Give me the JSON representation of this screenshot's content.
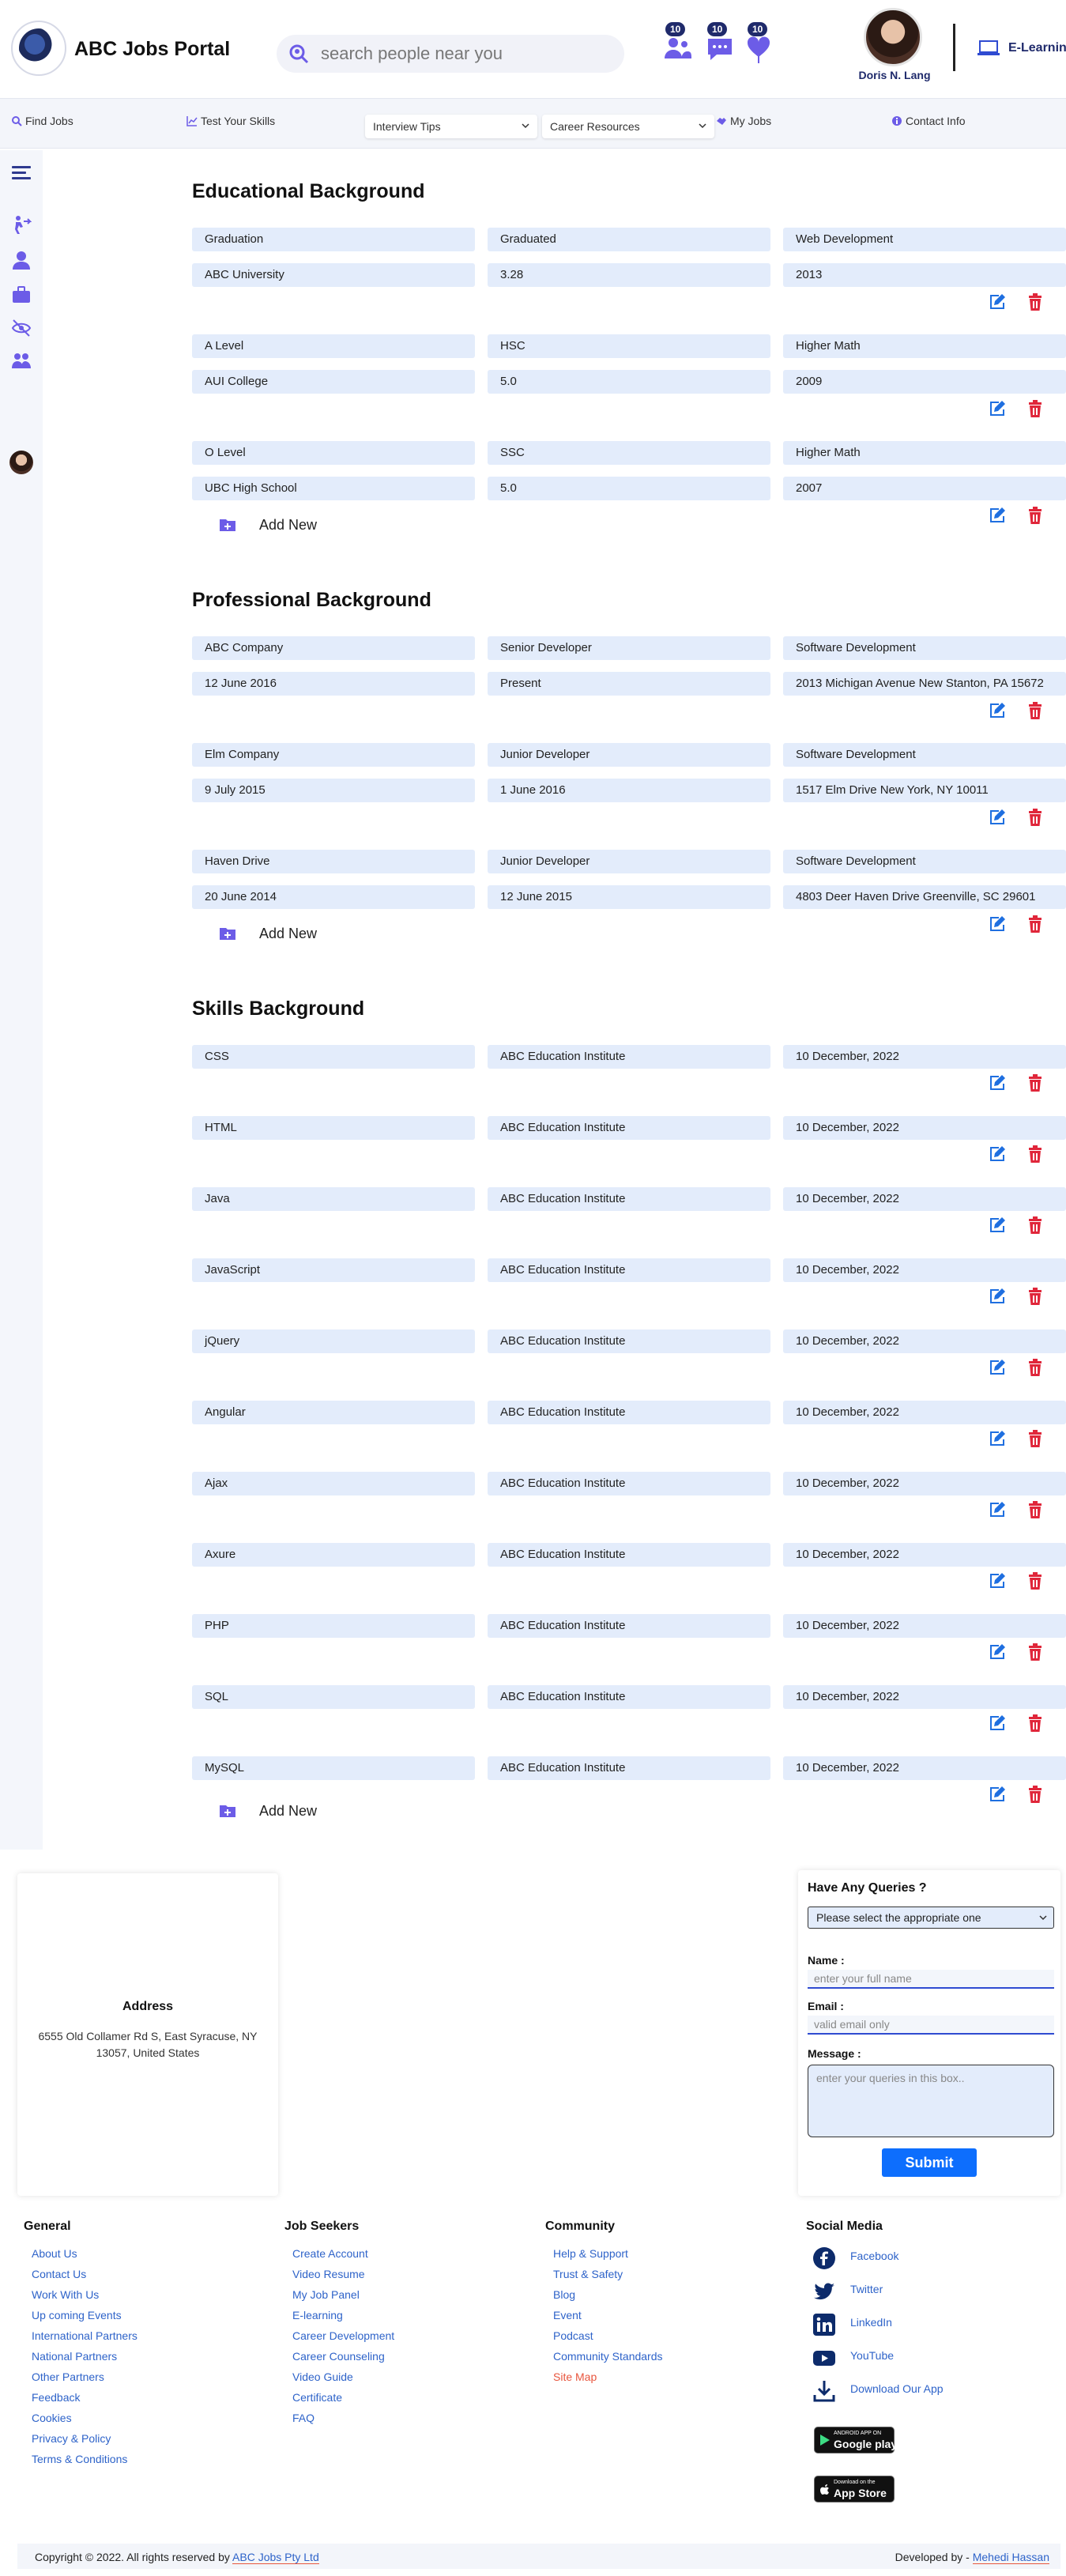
{
  "header": {
    "title": "ABC Jobs Portal",
    "search_placeholder": "search people near you",
    "badges": {
      "people": "10",
      "messages": "10",
      "likes": "10"
    },
    "user_name": "Doris N. Lang",
    "elearning": "E-Learning"
  },
  "nav": {
    "find_jobs": "Find Jobs",
    "test_skills": "Test Your Skills",
    "interview_tips": "Interview Tips",
    "career_resources": "Career Resources",
    "my_jobs": "My Jobs",
    "contact_info": "Contact Info"
  },
  "education": {
    "title": "Educational Background",
    "entries": [
      {
        "a": "Graduation",
        "b": "Graduated",
        "c": "Web Development",
        "d": "ABC University",
        "e": "3.28",
        "f": "2013"
      },
      {
        "a": "A Level",
        "b": "HSC",
        "c": "Higher Math",
        "d": "AUI College",
        "e": "5.0",
        "f": "2009"
      },
      {
        "a": "O Level",
        "b": "SSC",
        "c": "Higher Math",
        "d": "UBC High School",
        "e": "5.0",
        "f": "2007"
      }
    ],
    "add_new": "Add New"
  },
  "professional": {
    "title": "Professional Background",
    "entries": [
      {
        "a": "ABC Company",
        "b": "Senior Developer",
        "c": "Software Development",
        "d": "12 June 2016",
        "e": "Present",
        "f": "2013 Michigan Avenue New Stanton, PA 15672"
      },
      {
        "a": "Elm Company",
        "b": "Junior Developer",
        "c": "Software Development",
        "d": "9 July 2015",
        "e": "1 June 2016",
        "f": "1517 Elm Drive New York, NY 10011"
      },
      {
        "a": "Haven Drive",
        "b": "Junior Developer",
        "c": "Software Development",
        "d": "20 June 2014",
        "e": "12 June 2015",
        "f": "4803 Deer Haven Drive Greenville, SC 29601"
      }
    ],
    "add_new": "Add New"
  },
  "skills": {
    "title": "Skills Background",
    "entries": [
      {
        "skill": "CSS",
        "institute": "ABC Education Institute",
        "date": "10 December, 2022"
      },
      {
        "skill": "HTML",
        "institute": "ABC Education Institute",
        "date": "10 December, 2022"
      },
      {
        "skill": "Java",
        "institute": "ABC Education Institute",
        "date": "10 December, 2022"
      },
      {
        "skill": "JavaScript",
        "institute": "ABC Education Institute",
        "date": "10 December, 2022"
      },
      {
        "skill": "jQuery",
        "institute": "ABC Education Institute",
        "date": "10 December, 2022"
      },
      {
        "skill": "Angular",
        "institute": "ABC Education Institute",
        "date": "10 December, 2022"
      },
      {
        "skill": "Ajax",
        "institute": "ABC Education Institute",
        "date": "10 December, 2022"
      },
      {
        "skill": "Axure",
        "institute": "ABC Education Institute",
        "date": "10 December, 2022"
      },
      {
        "skill": "PHP",
        "institute": "ABC Education Institute",
        "date": "10 December, 2022"
      },
      {
        "skill": "SQL",
        "institute": "ABC Education Institute",
        "date": "10 December, 2022"
      },
      {
        "skill": "MySQL",
        "institute": "ABC Education Institute",
        "date": "10 December, 2022"
      }
    ],
    "add_new": "Add New"
  },
  "address": {
    "title": "Address",
    "text": "6555 Old Collamer Rd S, East Syracuse, NY 13057, United States"
  },
  "query": {
    "title": "Have Any Queries ?",
    "select": "Please select the appropriate one",
    "name_label": "Name :",
    "name_placeholder": "enter your full name",
    "email_label": "Email :",
    "email_placeholder": "valid email only",
    "message_label": "Message :",
    "message_placeholder": "enter your queries in this box..",
    "submit": "Submit"
  },
  "footer": {
    "general": {
      "title": "General",
      "links": [
        "About Us",
        "Contact Us",
        "Work With Us",
        "Up coming Events",
        "International Partners",
        "National Partners",
        "Other Partners",
        "Feedback",
        "Cookies",
        "Privacy & Policy",
        "Terms & Conditions"
      ]
    },
    "job_seekers": {
      "title": "Job Seekers",
      "links": [
        "Create Account",
        "Video Resume",
        "My Job Panel",
        "E-learning",
        "Career Development",
        "Career Counseling",
        "Video Guide",
        "Certificate",
        "FAQ"
      ]
    },
    "community": {
      "title": "Community",
      "links": [
        "Help & Support",
        "Trust & Safety",
        "Blog",
        "Event",
        "Podcast",
        "Community Standards",
        "Site Map"
      ]
    },
    "social": {
      "title": "Social Media",
      "links": [
        "Facebook",
        "Twitter",
        "LinkedIn",
        "YouTube",
        "Download Our App"
      ]
    },
    "google_play_small": "ANDROID APP ON",
    "google_play_big": "Google play",
    "app_store_small": "Download on the",
    "app_store_big": "App Store"
  },
  "bottom": {
    "copyright": "Copyright © 2022. All rights reserved by",
    "company": "ABC Jobs Pty Ltd",
    "developed": "Developed by -",
    "developer": "Mehedi Hassan"
  },
  "colors": {
    "accent": "#6c5ce7",
    "field_bg": "#e3ecfb",
    "edit_icon": "#1f6fe0",
    "delete_icon": "#e0263a",
    "link": "#2e63c9"
  }
}
